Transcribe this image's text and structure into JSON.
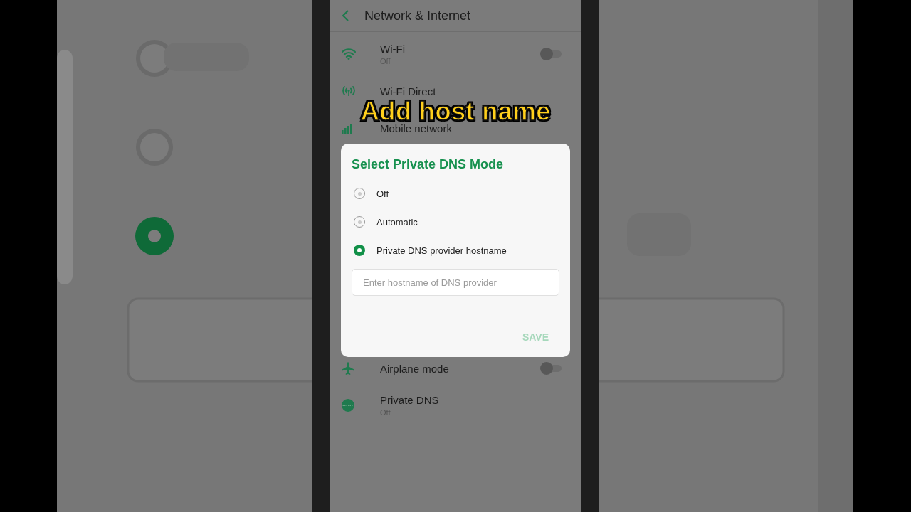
{
  "header": {
    "title": "Network & Internet"
  },
  "settings": [
    {
      "kind": "toggle",
      "label": "Wi-Fi",
      "subtitle": "Off",
      "on": false
    },
    {
      "kind": "link",
      "label": "Wi-Fi Direct"
    },
    {
      "kind": "link",
      "label": "Mobile network"
    },
    {
      "kind": "toggle",
      "label": "Airplane mode",
      "on": false
    },
    {
      "kind": "link",
      "label": "Private DNS",
      "subtitle": "Off"
    }
  ],
  "dialog": {
    "title": "Select Private DNS Mode",
    "options": [
      {
        "label": "Off",
        "selected": false
      },
      {
        "label": "Automatic",
        "selected": false
      },
      {
        "label": "Private DNS provider hostname",
        "selected": true
      }
    ],
    "hostname_field": {
      "placeholder": "Enter hostname of DNS provider"
    },
    "save_button": {
      "label": "SAVE",
      "disabled": true
    }
  },
  "caption": "Add host name"
}
